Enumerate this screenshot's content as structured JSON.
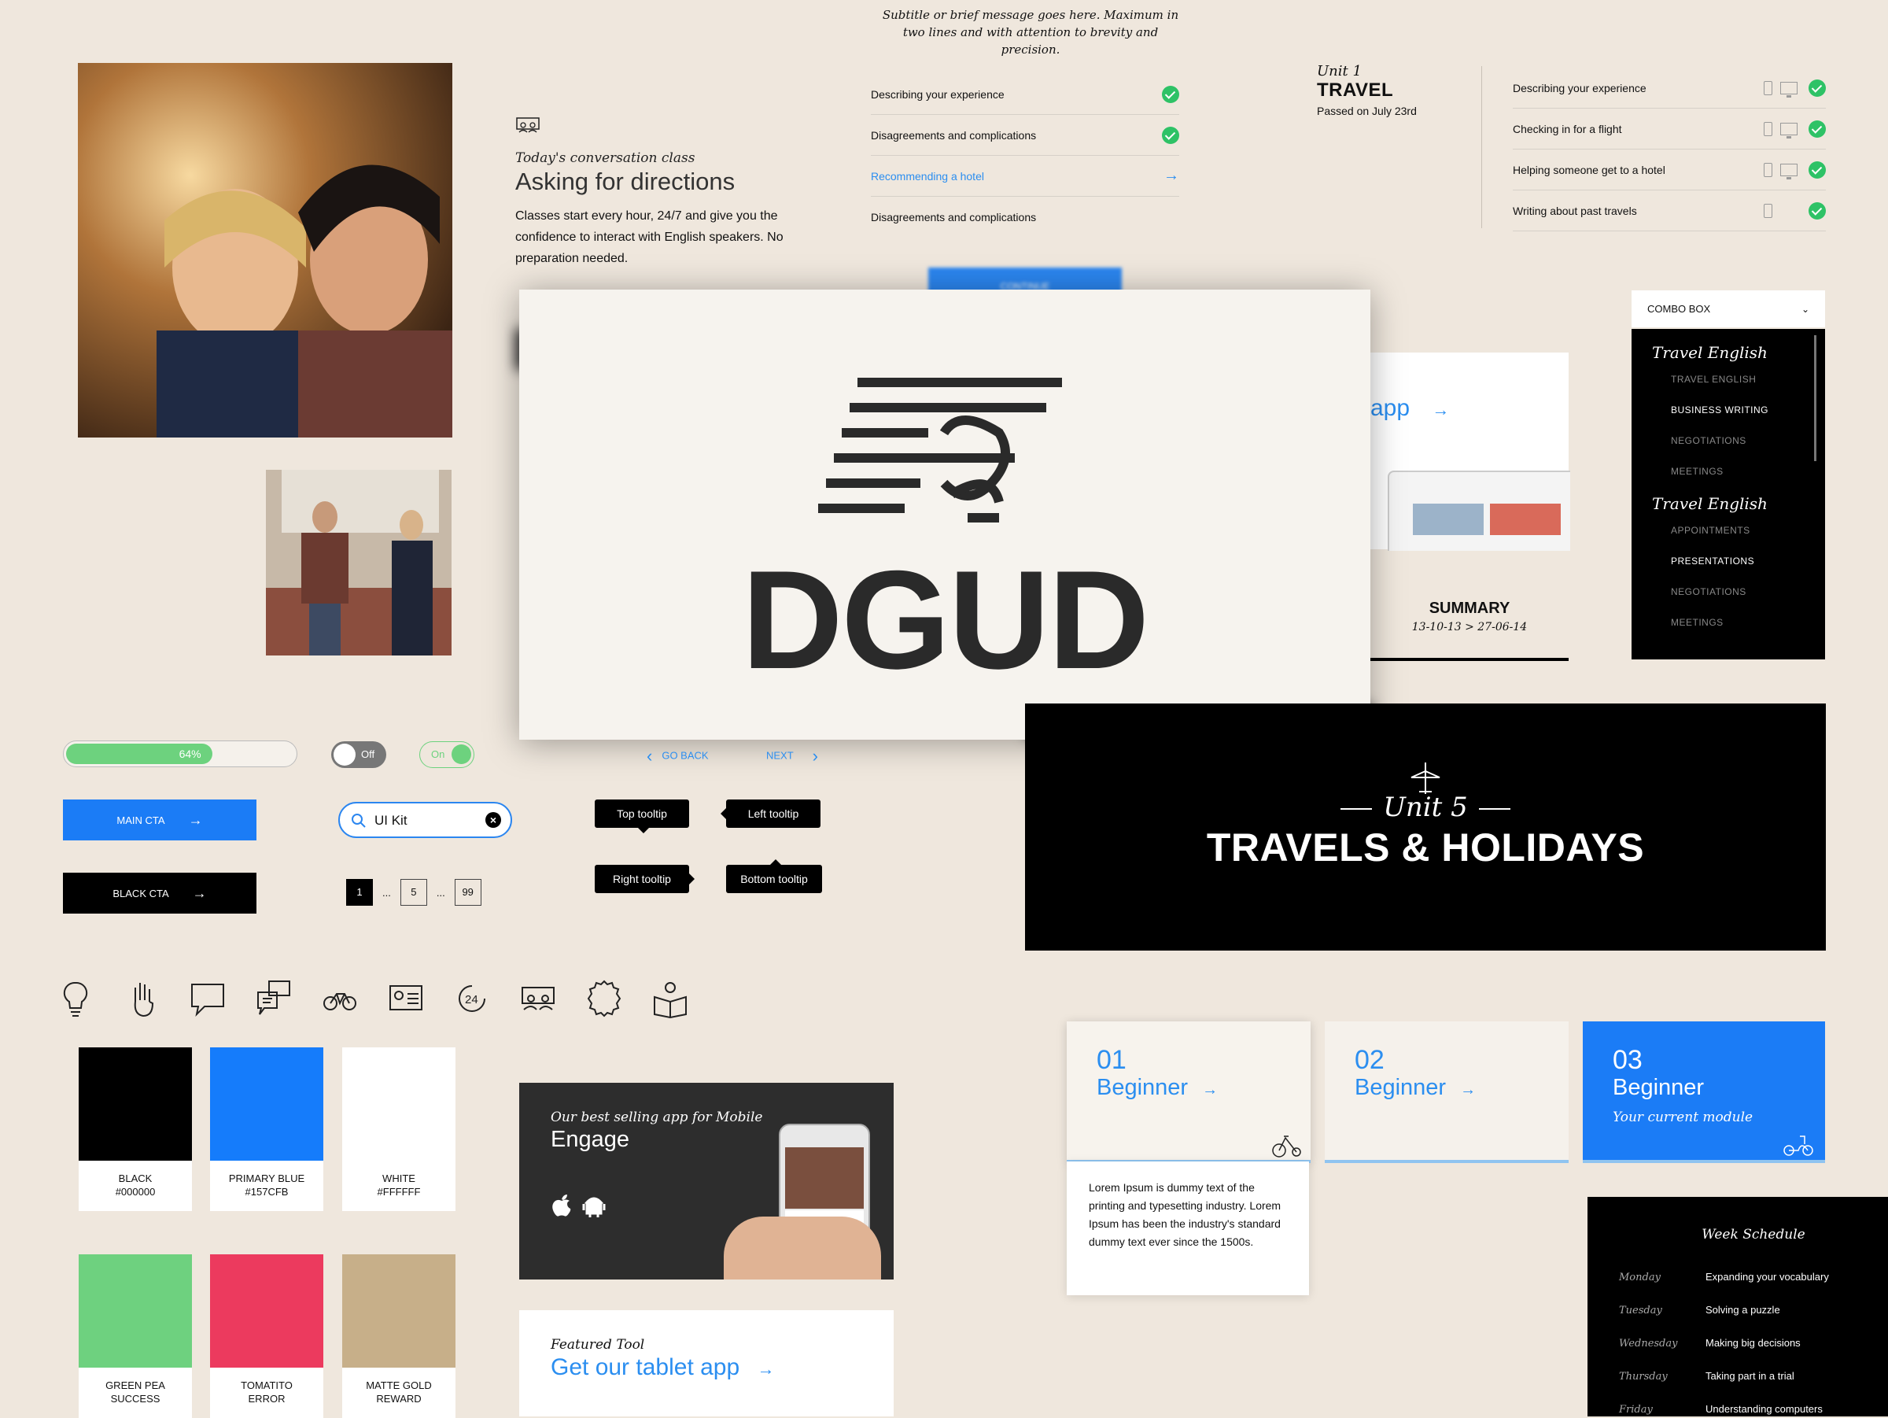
{
  "subtitle_message": "Subtitle or brief message goes here. Maximum in two lines and with attention to brevity and precision.",
  "conversation": {
    "kicker": "Today's conversation class",
    "title": "Asking for directions",
    "body": "Classes start every hour, 24/7 and give you the confidence to interact with English speakers. No preparation needed."
  },
  "lessons": [
    {
      "label": "Describing your experience",
      "state": "done"
    },
    {
      "label": "Disagreements and complications",
      "state": "done"
    },
    {
      "label": "Recommending a hotel",
      "state": "current"
    },
    {
      "label": "Disagreements and complications",
      "state": "todo"
    }
  ],
  "unit": {
    "number": "Unit 1",
    "title": "TRAVEL",
    "passed": "Passed on July 23rd"
  },
  "unit_lessons": [
    {
      "label": "Describing your experience",
      "monitor": true
    },
    {
      "label": "Checking in for a flight",
      "monitor": true
    },
    {
      "label": "Helping someone get to a hotel",
      "monitor": true
    },
    {
      "label": "Writing about past travels",
      "monitor": false
    }
  ],
  "continue_label": "CONTINUE",
  "modal": {
    "word": "DGUD"
  },
  "tablet_card_word": "app",
  "summary": {
    "title": "SUMMARY",
    "dates": "13-10-13 > 27-06-14"
  },
  "combo": {
    "label": "COMBO BOX",
    "groups": [
      {
        "name": "Travel English",
        "options": [
          {
            "label": "TRAVEL ENGLISH",
            "active": false
          },
          {
            "label": "BUSINESS WRITING",
            "active": true
          },
          {
            "label": "NEGOTIATIONS",
            "active": false
          },
          {
            "label": "MEETINGS",
            "active": false
          }
        ]
      },
      {
        "name": "Travel English",
        "options": [
          {
            "label": "APPOINTMENTS",
            "active": false
          },
          {
            "label": "PRESENTATIONS",
            "active": true
          },
          {
            "label": "NEGOTIATIONS",
            "active": false
          },
          {
            "label": "MEETINGS",
            "active": false
          }
        ]
      }
    ]
  },
  "unit5": {
    "number": "Unit 5",
    "title": "TRAVELS & HOLIDAYS"
  },
  "controls": {
    "progress": 0.64,
    "progress_label": "64%",
    "toggle_off": "Off",
    "toggle_on": "On",
    "go_back": "GO BACK",
    "next": "NEXT",
    "main_cta": "MAIN CTA",
    "black_cta": "BLACK CTA",
    "search_value": "UI Kit",
    "pages": [
      "1",
      "5",
      "99"
    ],
    "ellipsis": "...",
    "tooltips": {
      "top": "Top tooltip",
      "left": "Left tooltip",
      "right": "Right tooltip",
      "bottom": "Bottom tooltip"
    },
    "arrow": "→"
  },
  "icons": [
    "lightbulb-icon",
    "hand-icon",
    "speech-bubble-icon",
    "chat-bubbles-icon",
    "bicycle-icon",
    "id-card-icon",
    "24-hours-icon",
    "classroom-icon",
    "badge-icon",
    "reading-icon"
  ],
  "swatches": [
    {
      "name": "BLACK",
      "code": "#000000",
      "color": "#000000"
    },
    {
      "name": "PRIMARY BLUE",
      "code": "#157CFB",
      "color": "#157CFB"
    },
    {
      "name": "WHITE",
      "code": "#FFFFFF",
      "color": "#FFFFFF"
    },
    {
      "name": "GREEN PEA",
      "code": "SUCCESS",
      "color": "#6ED17F"
    },
    {
      "name": "TOMATITO",
      "code": "ERROR",
      "color": "#EC3A5E"
    },
    {
      "name": "MATTE GOLD",
      "code": "REWARD",
      "color": "#C7AF89"
    }
  ],
  "engage": {
    "kicker": "Our best selling app for Mobile",
    "title": "Engage"
  },
  "featured": {
    "kicker": "Featured Tool",
    "title": "Get our tablet app"
  },
  "levels": [
    {
      "number": "01",
      "name": "Beginner",
      "current": ""
    },
    {
      "number": "02",
      "name": "Beginner",
      "current": ""
    },
    {
      "number": "03",
      "name": "Beginner",
      "current": "Your current module"
    }
  ],
  "lorem": "Lorem Ipsum is dummy text of the printing and typesetting industry. Lorem Ipsum has been the industry's standard dummy text ever since the 1500s.",
  "week": {
    "title": "Week Schedule",
    "days": [
      {
        "day": "Monday",
        "topic": "Expanding your vocabulary"
      },
      {
        "day": "Tuesday",
        "topic": "Solving a puzzle"
      },
      {
        "day": "Wednesday",
        "topic": "Making big decisions"
      },
      {
        "day": "Thursday",
        "topic": "Taking part in a trial"
      },
      {
        "day": "Friday",
        "topic": "Understanding computers"
      }
    ]
  },
  "colors": {
    "accent_blue": "#2b8ef0",
    "primary_blue": "#157CFB",
    "success": "#2ec266",
    "background": "#efe7dd"
  }
}
